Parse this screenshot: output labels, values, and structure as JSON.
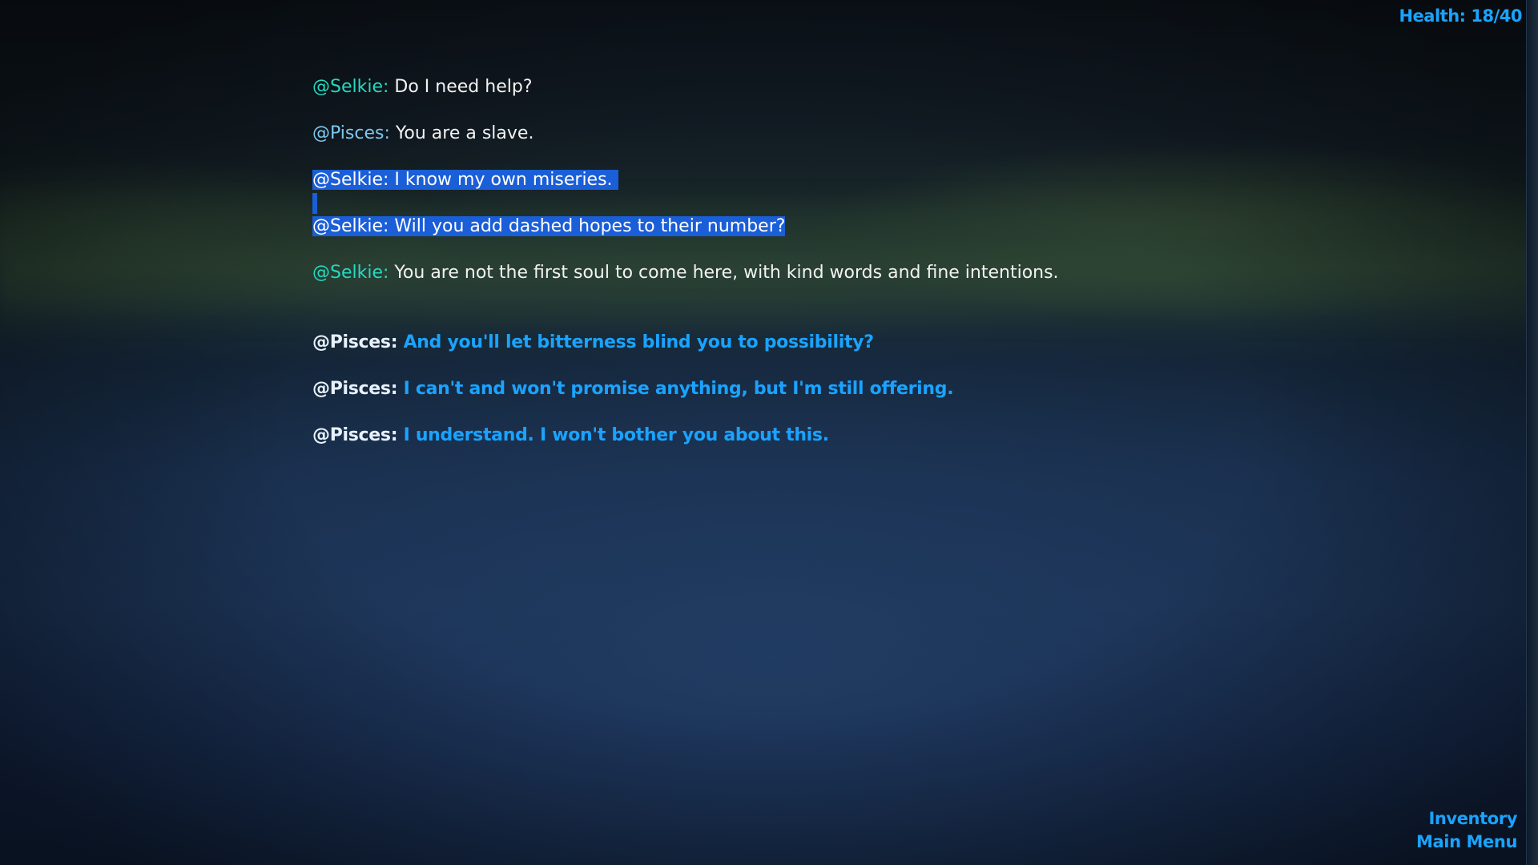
{
  "hud": {
    "health": "Health: 18/40"
  },
  "dialogue": [
    {
      "speaker": "@Selkie:",
      "text": " Do I need help?"
    },
    {
      "speaker": "@Pisces:",
      "text": " You are a slave."
    },
    {
      "speaker": "@Selkie:",
      "text": " I know my own miseries."
    },
    {
      "speaker": "@Selkie:",
      "text": " Will you add dashed hopes to their number?"
    },
    {
      "speaker": "@Selkie:",
      "text": " You are not the first soul to come here, with kind words and fine intentions."
    }
  ],
  "choices": [
    {
      "speaker": "@Pisces:",
      "text": " And you'll let bitterness blind you to possibility?"
    },
    {
      "speaker": "@Pisces:",
      "text": " I can't and won't promise anything, but I'm still offering."
    },
    {
      "speaker": "@Pisces:",
      "text": " I understand. I won't bother you about this."
    }
  ],
  "menu": {
    "inventory": "Inventory",
    "main_menu": "Main Menu"
  },
  "colors": {
    "accent": "#1aa3ff",
    "selkie_name": "#26d9c0",
    "pisces_name": "#7ec8f0",
    "selection": "#1a5ed8"
  }
}
